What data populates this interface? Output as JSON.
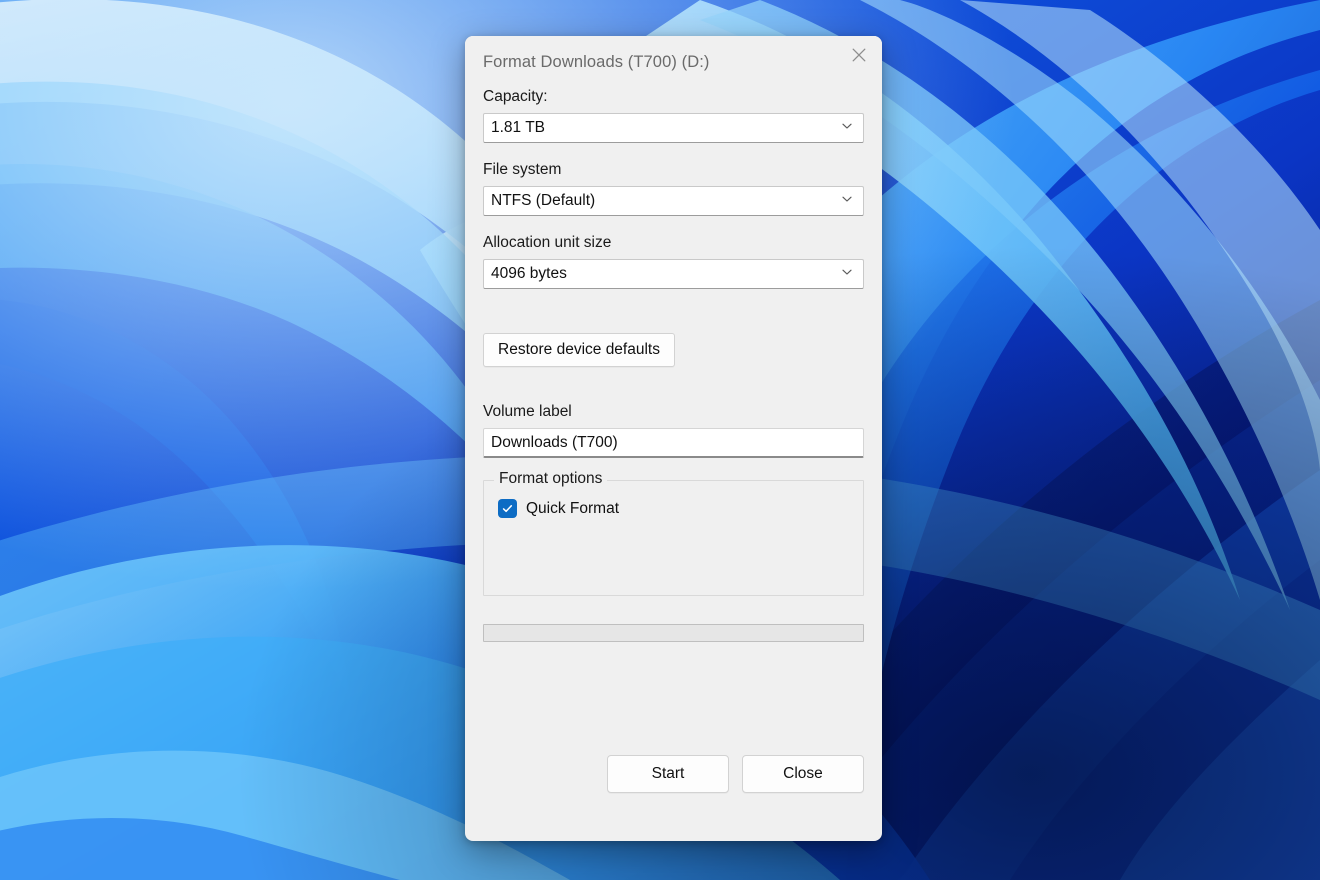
{
  "desktop": {
    "wallpaper_name": "windows-bloom-wallpaper",
    "colors": {
      "deep_blue": "#0a3fc4",
      "mid_blue": "#1b6ff0",
      "light_blue": "#45b6f7",
      "pale_blue": "#9fd9fb",
      "navy": "#071a66",
      "dark_navy": "#03103a"
    }
  },
  "dialog": {
    "title": "Format Downloads (T700) (D:)",
    "close_icon": "close-icon",
    "capacity": {
      "label": "Capacity:",
      "value": "1.81 TB",
      "chevron_icon": "chevron-down-icon"
    },
    "file_system": {
      "label": "File system",
      "value": "NTFS (Default)",
      "chevron_icon": "chevron-down-icon"
    },
    "allocation_unit": {
      "label": "Allocation unit size",
      "value": "4096 bytes",
      "chevron_icon": "chevron-down-icon"
    },
    "restore_defaults_label": "Restore device defaults",
    "volume_label": {
      "label": "Volume label",
      "value": "Downloads (T700)"
    },
    "format_options": {
      "legend": "Format options",
      "quick_format": {
        "label": "Quick Format",
        "checked": true,
        "check_icon": "checkmark-icon",
        "accent_color": "#0d6cc4"
      }
    },
    "progress": {
      "percent": 0
    },
    "buttons": {
      "start": "Start",
      "close": "Close"
    }
  }
}
